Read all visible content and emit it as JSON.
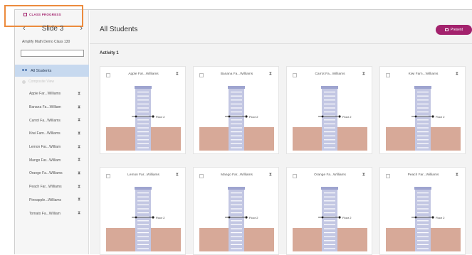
{
  "header": {
    "class_progress_label": "CLASS PROGRESS",
    "slide_label": "Slide 3",
    "prev_icon": "chevron-left-icon",
    "next_icon": "chevron-right-icon",
    "class_name": "Amplify Math Demo Class 130",
    "search_placeholder": ""
  },
  "sidebar": {
    "all_students_label": "All Students",
    "composite_label": "Composite View",
    "students": [
      "Apple Far...Williams",
      "Banana Fa...William",
      "Carrot Fa...Williams",
      "Kiwi Farn...Williams",
      "Lemon Far...William",
      "Mango Far...William",
      "Orange Fa...Williams",
      "Peach Far...Williams",
      "Pineapple...Williams",
      "Tomato Fa...William"
    ]
  },
  "main": {
    "title": "All Students",
    "present_label": "Present",
    "activity_label": "Activity 1",
    "floor_label": "Floor 2",
    "cards": [
      "Apple Far...Williams",
      "Banana Fa...Williams",
      "Carrot Fa...Williams",
      "Kiwi Farn...Williams",
      "Lemon Far...Williams",
      "Mango Far...Williams",
      "Orange Fa...Williams",
      "Peach Far...Williams"
    ]
  },
  "colors": {
    "accent": "#a3226d",
    "selected_bg": "#c7d9ef",
    "highlight_box": "#ec8b3d",
    "ground": "#d7a998",
    "tower": "#c3c7e3"
  }
}
